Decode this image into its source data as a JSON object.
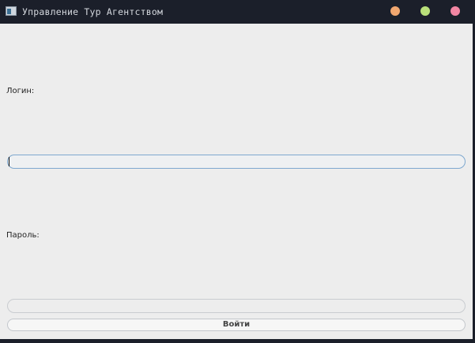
{
  "window": {
    "title": "Управление Тур Агентством",
    "icon": "app-window-icon",
    "controls": {
      "minimize_color": "#f0a770",
      "maximize_color": "#b9e07a",
      "close_color": "#f286a3"
    }
  },
  "form": {
    "login_label": "Логин:",
    "login_value": "",
    "password_label": "Пароль:",
    "password_value": "",
    "submit_label": "Войти"
  }
}
